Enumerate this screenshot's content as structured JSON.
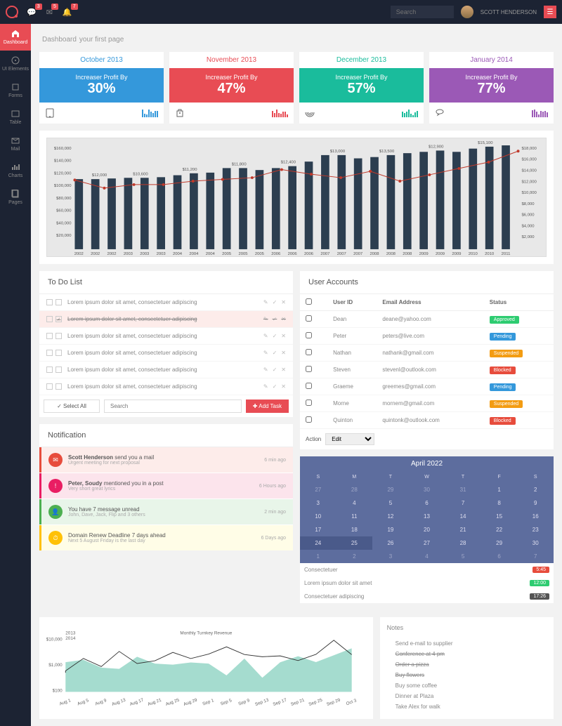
{
  "header": {
    "badges": {
      "comments": "3",
      "mail": "5",
      "bell": "7"
    },
    "search_placeholder": "Search",
    "user_name": "SCOTT HENDERSON"
  },
  "sidebar": {
    "items": [
      {
        "label": "Dashboard"
      },
      {
        "label": "UI Elements"
      },
      {
        "label": "Forms"
      },
      {
        "label": "Table"
      },
      {
        "label": "Mail"
      },
      {
        "label": "Charts"
      },
      {
        "label": "Pages"
      }
    ]
  },
  "page": {
    "title": "Dashboard",
    "subtitle": "your first page"
  },
  "stats": [
    {
      "month": "October 2013",
      "sub": "Increaser Profit By",
      "val": "30%",
      "color": "blue"
    },
    {
      "month": "November 2013",
      "sub": "Increaser Profit By",
      "val": "47%",
      "color": "red"
    },
    {
      "month": "December 2013",
      "sub": "Increaser Profit By",
      "val": "57%",
      "color": "teal"
    },
    {
      "month": "January 2014",
      "sub": "Increaser Profit By",
      "val": "77%",
      "color": "purple"
    }
  ],
  "chart_data": {
    "type": "bar",
    "title": "",
    "ylim_left": [
      0,
      160000
    ],
    "ylim_right": [
      0,
      18000
    ],
    "yticks_left": [
      "$20,000",
      "$40,000",
      "$60,000",
      "$80,000",
      "$100,000",
      "$120,000",
      "$140,000",
      "$160,000"
    ],
    "yticks_right": [
      "$2,000",
      "$4,000",
      "$6,000",
      "$8,000",
      "$10,000",
      "$12,000",
      "$14,000",
      "$16,000",
      "$18,000"
    ],
    "categories": [
      "2002",
      "2002",
      "2002",
      "2003",
      "2003",
      "2003",
      "2004",
      "2004",
      "2004",
      "2005",
      "2005",
      "2005",
      "2006",
      "2006",
      "2006",
      "2007",
      "2007",
      "2007",
      "2008",
      "2008",
      "2008",
      "2009",
      "2009",
      "2009",
      "2010",
      "2010",
      "2011"
    ],
    "bars": [
      108000,
      108000,
      109000,
      110000,
      110000,
      111000,
      114000,
      117000,
      118000,
      125000,
      125000,
      122000,
      125000,
      128000,
      135000,
      145000,
      145000,
      140000,
      142000,
      145000,
      148000,
      150000,
      152000,
      150000,
      155000,
      158000,
      160000
    ],
    "labels": [
      {
        "x": 1.5,
        "text": "$12,000"
      },
      {
        "x": 4.0,
        "text": "$10,600"
      },
      {
        "x": 7.0,
        "text": "$11,200"
      },
      {
        "x": 10.0,
        "text": "$11,800"
      },
      {
        "x": 13.0,
        "text": "$12,400"
      },
      {
        "x": 16.0,
        "text": "$13,000"
      },
      {
        "x": 19.0,
        "text": "$13,500"
      },
      {
        "x": 22.0,
        "text": "$12,900"
      },
      {
        "x": 25.0,
        "text": "$15,100"
      }
    ],
    "line_points": [
      12000,
      10600,
      11200,
      11200,
      11800,
      12100,
      12400,
      13800,
      13000,
      12400,
      13500,
      11800,
      12900,
      14000,
      15100,
      17000
    ]
  },
  "todo": {
    "title": "To Do List",
    "items": [
      {
        "text": "Lorem ipsum dolor sit amet, consectetuer adipiscing",
        "done": false
      },
      {
        "text": "Lorem ipsum dolor sit amet, consectetuer adipiscing",
        "done": true
      },
      {
        "text": "Lorem ipsum dolor sit amet, consectetuer adipiscing",
        "done": false
      },
      {
        "text": "Lorem ipsum dolor sit amet, consectetuer adipiscing",
        "done": false
      },
      {
        "text": "Lorem ipsum dolor sit amet, consectetuer adipiscing",
        "done": false
      },
      {
        "text": "Lorem ipsum dolor sit amet, consectetuer adipiscing",
        "done": false
      }
    ],
    "select_all": "Select All",
    "search_placeholder": "Search",
    "add_label": "Add Task"
  },
  "notif": {
    "title": "Notification",
    "items": [
      {
        "color": "red",
        "title": "Scott Henderson",
        "mid": " send you a mail",
        "sub": "Urgent meeting for next proposal",
        "time": "6 min ago"
      },
      {
        "color": "pink",
        "title": "Peter, Soudy",
        "mid": " mentioned you in a post",
        "sub": "Very short great lyrics",
        "time": "6 Hours ago"
      },
      {
        "color": "green",
        "title": "",
        "mid": "You have 7 message unread",
        "sub": "John, Dave, Jack, Flip and 3 others",
        "time": "2 min ago"
      },
      {
        "color": "yellow",
        "title": "",
        "mid": "Domain Renew Deadline 7 days ahead",
        "sub": "Next 5 August Friday is the last day",
        "time": "6 Days ago"
      }
    ]
  },
  "accounts": {
    "title": "User Accounts",
    "headers": [
      "",
      "User ID",
      "Email Address",
      "Status"
    ],
    "rows": [
      {
        "id": "Dean",
        "email": "deane@yahoo.com",
        "status": "Approved",
        "cls": "approved"
      },
      {
        "id": "Peter",
        "email": "peters@live.com",
        "status": "Pending",
        "cls": "pending"
      },
      {
        "id": "Nathan",
        "email": "nathank@gmail.com",
        "status": "Suspended",
        "cls": "suspended"
      },
      {
        "id": "Steven",
        "email": "stevenl@outlook.com",
        "status": "Blocked",
        "cls": "blocked"
      },
      {
        "id": "Graeme",
        "email": "greemes@gmail.com",
        "status": "Pending",
        "cls": "pending"
      },
      {
        "id": "Morne",
        "email": "mornem@gmail.com",
        "status": "Suspended",
        "cls": "suspended"
      },
      {
        "id": "Quinton",
        "email": "quintonk@outlook.com",
        "status": "Blocked",
        "cls": "blocked"
      }
    ],
    "action_label": "Action",
    "action_value": "Edit"
  },
  "calendar": {
    "month": "April 2022",
    "dow": [
      "S",
      "M",
      "T",
      "W",
      "T",
      "F",
      "S"
    ],
    "days": [
      {
        "n": "27",
        "out": true
      },
      {
        "n": "28",
        "out": true
      },
      {
        "n": "29",
        "out": true
      },
      {
        "n": "30",
        "out": true
      },
      {
        "n": "31",
        "out": true
      },
      {
        "n": "1"
      },
      {
        "n": "2"
      },
      {
        "n": "3"
      },
      {
        "n": "4"
      },
      {
        "n": "5"
      },
      {
        "n": "6"
      },
      {
        "n": "7"
      },
      {
        "n": "8"
      },
      {
        "n": "9"
      },
      {
        "n": "10"
      },
      {
        "n": "11"
      },
      {
        "n": "12"
      },
      {
        "n": "13"
      },
      {
        "n": "14"
      },
      {
        "n": "15"
      },
      {
        "n": "16"
      },
      {
        "n": "17"
      },
      {
        "n": "18"
      },
      {
        "n": "19"
      },
      {
        "n": "20"
      },
      {
        "n": "21"
      },
      {
        "n": "22"
      },
      {
        "n": "23"
      },
      {
        "n": "24",
        "today": true
      },
      {
        "n": "25",
        "today": true
      },
      {
        "n": "26"
      },
      {
        "n": "27"
      },
      {
        "n": "28"
      },
      {
        "n": "29"
      },
      {
        "n": "30"
      },
      {
        "n": "1",
        "out": true
      },
      {
        "n": "2",
        "out": true
      },
      {
        "n": "3",
        "out": true
      },
      {
        "n": "4",
        "out": true
      },
      {
        "n": "5",
        "out": true
      },
      {
        "n": "6",
        "out": true
      },
      {
        "n": "7",
        "out": true
      }
    ],
    "events": [
      {
        "text": "Consectetuer",
        "badge": "5:45",
        "cls": "red"
      },
      {
        "text": "Lorem ipsum dolor sit amet",
        "badge": "12:00",
        "cls": "green"
      },
      {
        "text": "Consectetuer adipiscing",
        "badge": "17:26",
        "cls": "dark"
      }
    ]
  },
  "turnkey": {
    "title": "Monthly Turnkey Revenue",
    "legend": [
      "2013",
      "2014"
    ],
    "yticks": [
      "$10,000",
      "$1,000",
      "$100"
    ],
    "xticks": [
      "Aug 1",
      "Aug 5",
      "Aug 9",
      "Aug 13",
      "Aug 17",
      "Aug 21",
      "Aug 25",
      "Aug 29",
      "Sep 1",
      "Sep 5",
      "Sep 9",
      "Sep 13",
      "Sep 17",
      "Sep 21",
      "Sep 25",
      "Sep 29",
      "Oct 3"
    ]
  },
  "notes": {
    "title": "Notes",
    "items": [
      {
        "text": "Send e-mail to supplier",
        "strike": false
      },
      {
        "text": "Conference at 4 pm",
        "strike": true
      },
      {
        "text": "Order a pizza",
        "strike": true
      },
      {
        "text": "Buy flowers",
        "strike": true
      },
      {
        "text": "Buy some coffee",
        "strike": false
      },
      {
        "text": "Dinner at Plaza",
        "strike": false
      },
      {
        "text": "Take Alex for walk",
        "strike": false
      }
    ]
  }
}
